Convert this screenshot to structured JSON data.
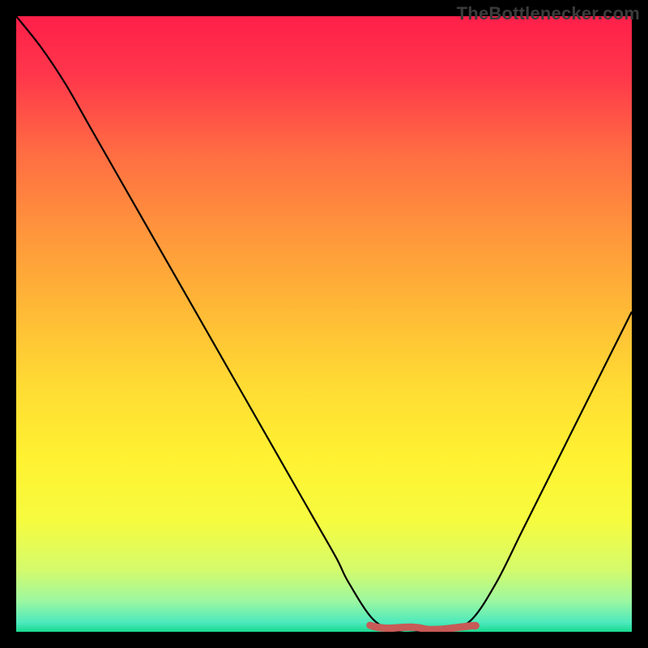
{
  "attribution": "TheBottlenecker.com",
  "chart_data": {
    "type": "line",
    "title": "",
    "xlabel": "",
    "ylabel": "",
    "xlim": [
      0,
      100
    ],
    "ylim": [
      0,
      100
    ],
    "x": [
      0,
      4,
      8,
      12,
      16,
      20,
      24,
      28,
      32,
      36,
      40,
      44,
      48,
      52,
      54,
      58,
      62,
      66,
      70,
      74,
      78,
      82,
      86,
      90,
      94,
      100
    ],
    "values": [
      100,
      95,
      89,
      82,
      75,
      68,
      61,
      54,
      47,
      40,
      33,
      26,
      19,
      12,
      8,
      2,
      0,
      0,
      0,
      2,
      8,
      16,
      24,
      32,
      40,
      52
    ],
    "flat_region": {
      "x_start": 58,
      "x_end": 74,
      "y": 0
    },
    "gradient_stops": [
      {
        "offset": 0.0,
        "color": "#ff1f4a"
      },
      {
        "offset": 0.1,
        "color": "#ff384b"
      },
      {
        "offset": 0.22,
        "color": "#ff6c43"
      },
      {
        "offset": 0.35,
        "color": "#ff953c"
      },
      {
        "offset": 0.48,
        "color": "#ffba36"
      },
      {
        "offset": 0.6,
        "color": "#ffdb33"
      },
      {
        "offset": 0.72,
        "color": "#fff232"
      },
      {
        "offset": 0.82,
        "color": "#f6fb3f"
      },
      {
        "offset": 0.9,
        "color": "#d4fb6c"
      },
      {
        "offset": 0.95,
        "color": "#9cf7a0"
      },
      {
        "offset": 0.985,
        "color": "#4de9bd"
      },
      {
        "offset": 1.0,
        "color": "#18d98f"
      }
    ],
    "curve_color": "#000000",
    "flat_marker_color": "#c85a57"
  }
}
